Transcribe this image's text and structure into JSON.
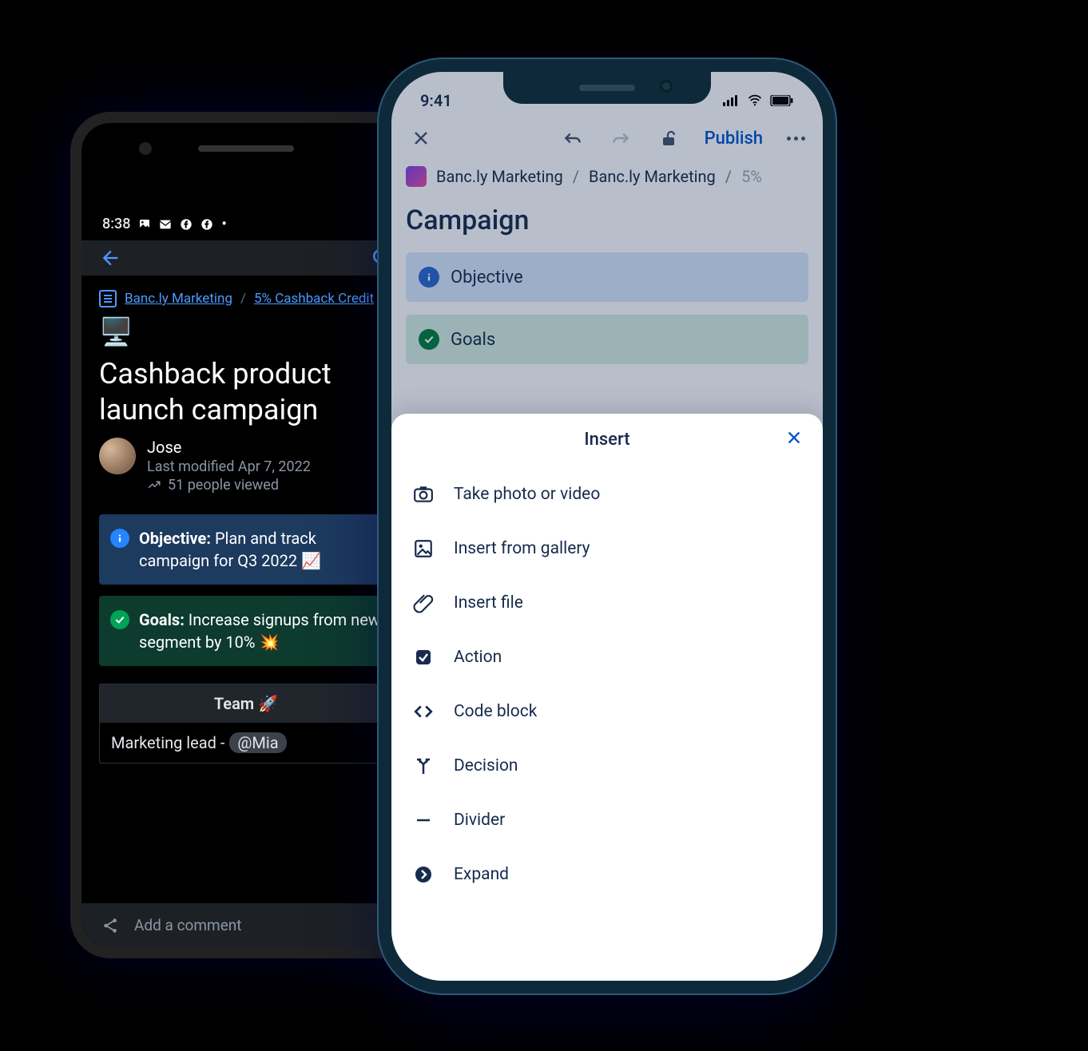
{
  "android": {
    "statusbar": {
      "time": "8:38"
    },
    "breadcrumb": {
      "space": "Banc.ly Marketing",
      "page": "5% Cashback Credit"
    },
    "title_prefix": "🖥️",
    "title": "Cashback product launch campaign",
    "author": {
      "name": "Jose",
      "modified": "Last modified Apr 7, 2022",
      "views": "51 people viewed"
    },
    "panels": {
      "objective_label": "Objective:",
      "objective_text": "Plan and track campaign for Q3 2022 📈",
      "goals_label": "Goals:",
      "goals_text": "Increase signups from new segment by 10% 💥"
    },
    "team": {
      "header": "Team 🚀",
      "row_prefix": "Marketing lead - ",
      "mention": "@Mia"
    },
    "footer": {
      "comment_placeholder": "Add a comment"
    }
  },
  "iphone": {
    "statusbar": {
      "time": "9:41"
    },
    "appbar": {
      "publish": "Publish"
    },
    "breadcrumb": {
      "part1": "Banc.ly Marketing",
      "part2": "Banc.ly Marketing",
      "part3": "5%"
    },
    "title": "Campaign",
    "panels": {
      "objective": "Objective",
      "goals": "Goals"
    },
    "sheet": {
      "title": "Insert",
      "items": [
        "Take photo or video",
        "Insert from gallery",
        "Insert file",
        "Action",
        "Code block",
        "Decision",
        "Divider",
        "Expand"
      ]
    }
  }
}
